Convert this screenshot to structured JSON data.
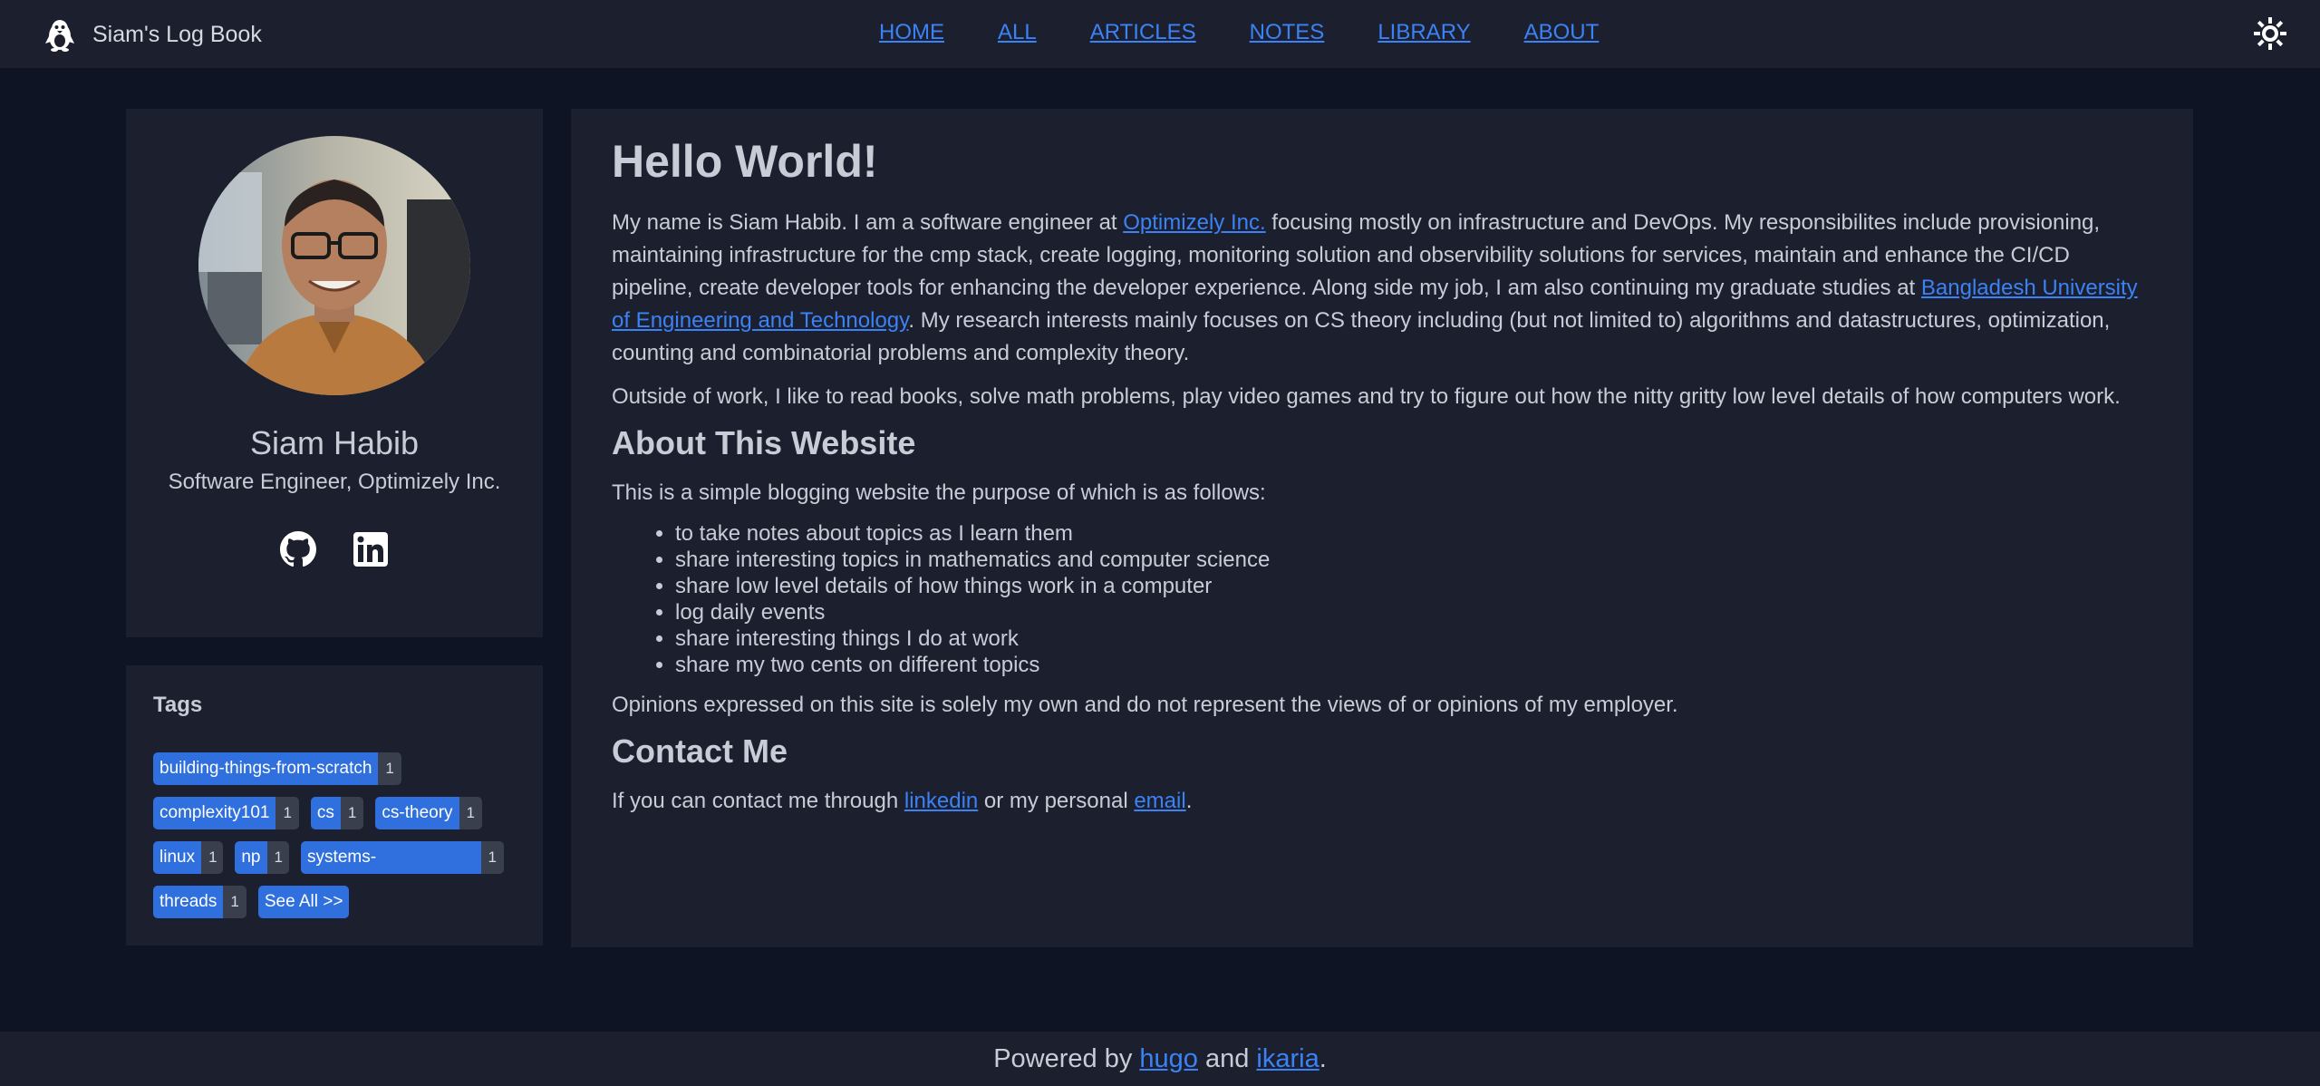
{
  "navbar": {
    "brand_title": "Siam's Log Book",
    "links": [
      "HOME",
      "ALL",
      "ARTICLES",
      "NOTES",
      "LIBRARY",
      "ABOUT"
    ]
  },
  "profile": {
    "name": "Siam Habib",
    "role": "Software Engineer, Optimizely Inc."
  },
  "tags": {
    "title": "Tags",
    "items": [
      {
        "name": "building-things-from-scratch",
        "count": "1"
      },
      {
        "name": "complexity101",
        "count": "1"
      },
      {
        "name": "cs",
        "count": "1"
      },
      {
        "name": "cs-theory",
        "count": "1"
      },
      {
        "name": "linux",
        "count": "1"
      },
      {
        "name": "np",
        "count": "1"
      },
      {
        "name": "systems-programming",
        "count": "1"
      },
      {
        "name": "threads",
        "count": "1"
      }
    ],
    "see_all": "See All >>"
  },
  "main": {
    "title": "Hello World!",
    "intro": {
      "t1": "My name is Siam Habib. I am a software engineer at ",
      "link1": "Optimizely Inc.",
      "t2": " focusing mostly on infrastructure and DevOps. My responsibilites include provisioning, maintaining infrastructure for the cmp stack, create logging, monitoring solution and observibility solutions for services, maintain and enhance the CI/CD pipeline, create developer tools for enhancing the developer experience. Along side my job, I am also continuing my graduate studies at ",
      "link2": "Bangladesh University of Engineering and Technology",
      "t3": ". My research interests mainly focuses on CS theory including (but not limited to) algorithms and datastructures, optimization, counting and combinatorial problems and complexity theory."
    },
    "outside": "Outside of work, I like to read books, solve math problems, play video games and try to figure out how the nitty gritty low level details of how computers work.",
    "about_heading": "About This Website",
    "about_intro": "This is a simple blogging website the purpose of which is as follows:",
    "purposes": [
      "to take notes about topics as I learn them",
      "share interesting topics in mathematics and computer science",
      "share low level details of how things work in a computer",
      "log daily events",
      "share interesting things I do at work",
      "share my two cents on different topics"
    ],
    "opinions": "Opinions expressed on this site is solely my own and do not represent the views of or opinions of my employer.",
    "contact_heading": "Contact Me",
    "contact": {
      "t1": "If you can contact me through ",
      "link1": "linkedin",
      "t2": " or my personal ",
      "link2": "email",
      "t3": "."
    }
  },
  "footer": {
    "t1": "Powered by ",
    "link1": "hugo",
    "t2": " and ",
    "link2": "ikaria",
    "t3": "."
  },
  "colors": {
    "background": "#0f1425",
    "card": "#1c202e",
    "link": "#3b82f6",
    "tag": "#2f6fde",
    "tag_count": "#3a3f4d",
    "text": "#c8ccd6"
  },
  "icons": {
    "brand": "penguin-icon",
    "theme": "sun-icon",
    "social": [
      "github-icon",
      "linkedin-icon"
    ]
  }
}
